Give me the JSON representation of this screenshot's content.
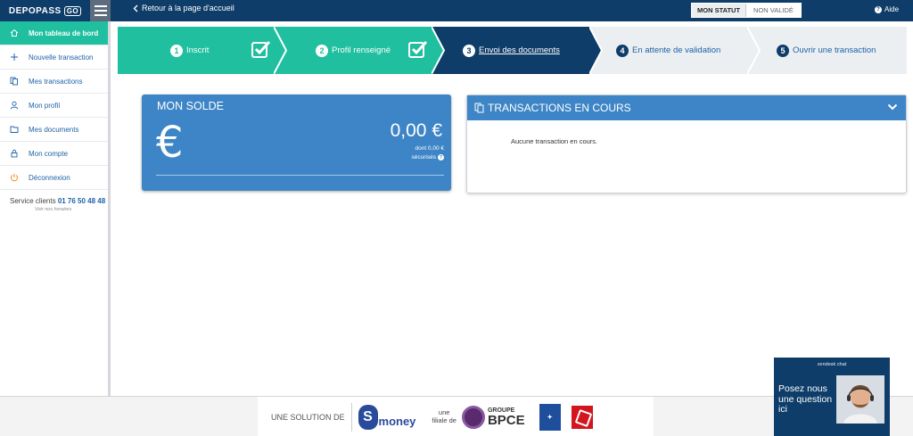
{
  "app": {
    "logo_text": "DEPOPASS",
    "back_link": "Retour à la page d'accueil",
    "status_label": "MON STATUT",
    "status_value": "NON VALIDÉ",
    "help": "Aide"
  },
  "sidebar": {
    "items": [
      {
        "label": "Mon tableau de bord",
        "icon": "home-icon",
        "active": true
      },
      {
        "label": "Nouvelle transaction",
        "icon": "plus-icon",
        "active": false
      },
      {
        "label": "Mes transactions",
        "icon": "documents-icon",
        "active": false
      },
      {
        "label": "Mon profil",
        "icon": "user-icon",
        "active": false
      },
      {
        "label": "Mes documents",
        "icon": "folder-icon",
        "active": false
      },
      {
        "label": "Mon compte",
        "icon": "lock-icon",
        "active": false
      },
      {
        "label": "Déconnexion",
        "icon": "power-icon",
        "active": false
      }
    ],
    "service_label": "Service clients",
    "service_phone": "01 76 50 48 48",
    "service_hours": "Voir nos horaires"
  },
  "stepper": {
    "steps": [
      {
        "num": "1",
        "label": "Inscrit",
        "state": "done"
      },
      {
        "num": "2",
        "label": "Profil renseigné",
        "state": "done"
      },
      {
        "num": "3",
        "label": "Envoi des documents",
        "state": "current"
      },
      {
        "num": "4",
        "label": "En attente de validation",
        "state": "todo"
      },
      {
        "num": "5",
        "label": "Ouvrir une transaction",
        "state": "todo"
      }
    ],
    "colors": {
      "done": "#1fbf9f",
      "current": "#0e3d69",
      "todo": "#eceff1"
    }
  },
  "balance": {
    "title": "MON SOLDE",
    "symbol": "€",
    "amount": "0,00 €",
    "secured_line1": "dont 0,00 €",
    "secured_line2": "sécurisés"
  },
  "transactions": {
    "title": "TRANSACTIONS EN COURS",
    "empty_text": "Aucune transaction en cours."
  },
  "footer": {
    "solution_text": "UNE SOLUTION DE",
    "smoney_s": "S",
    "smoney_text": "money",
    "filiale_line1": "une",
    "filiale_line2": "filiale de",
    "groupe": "GROUPE",
    "bpce": "BPCE"
  },
  "chat": {
    "title": "zendesk chat",
    "message": "Posez nous une question ici"
  }
}
